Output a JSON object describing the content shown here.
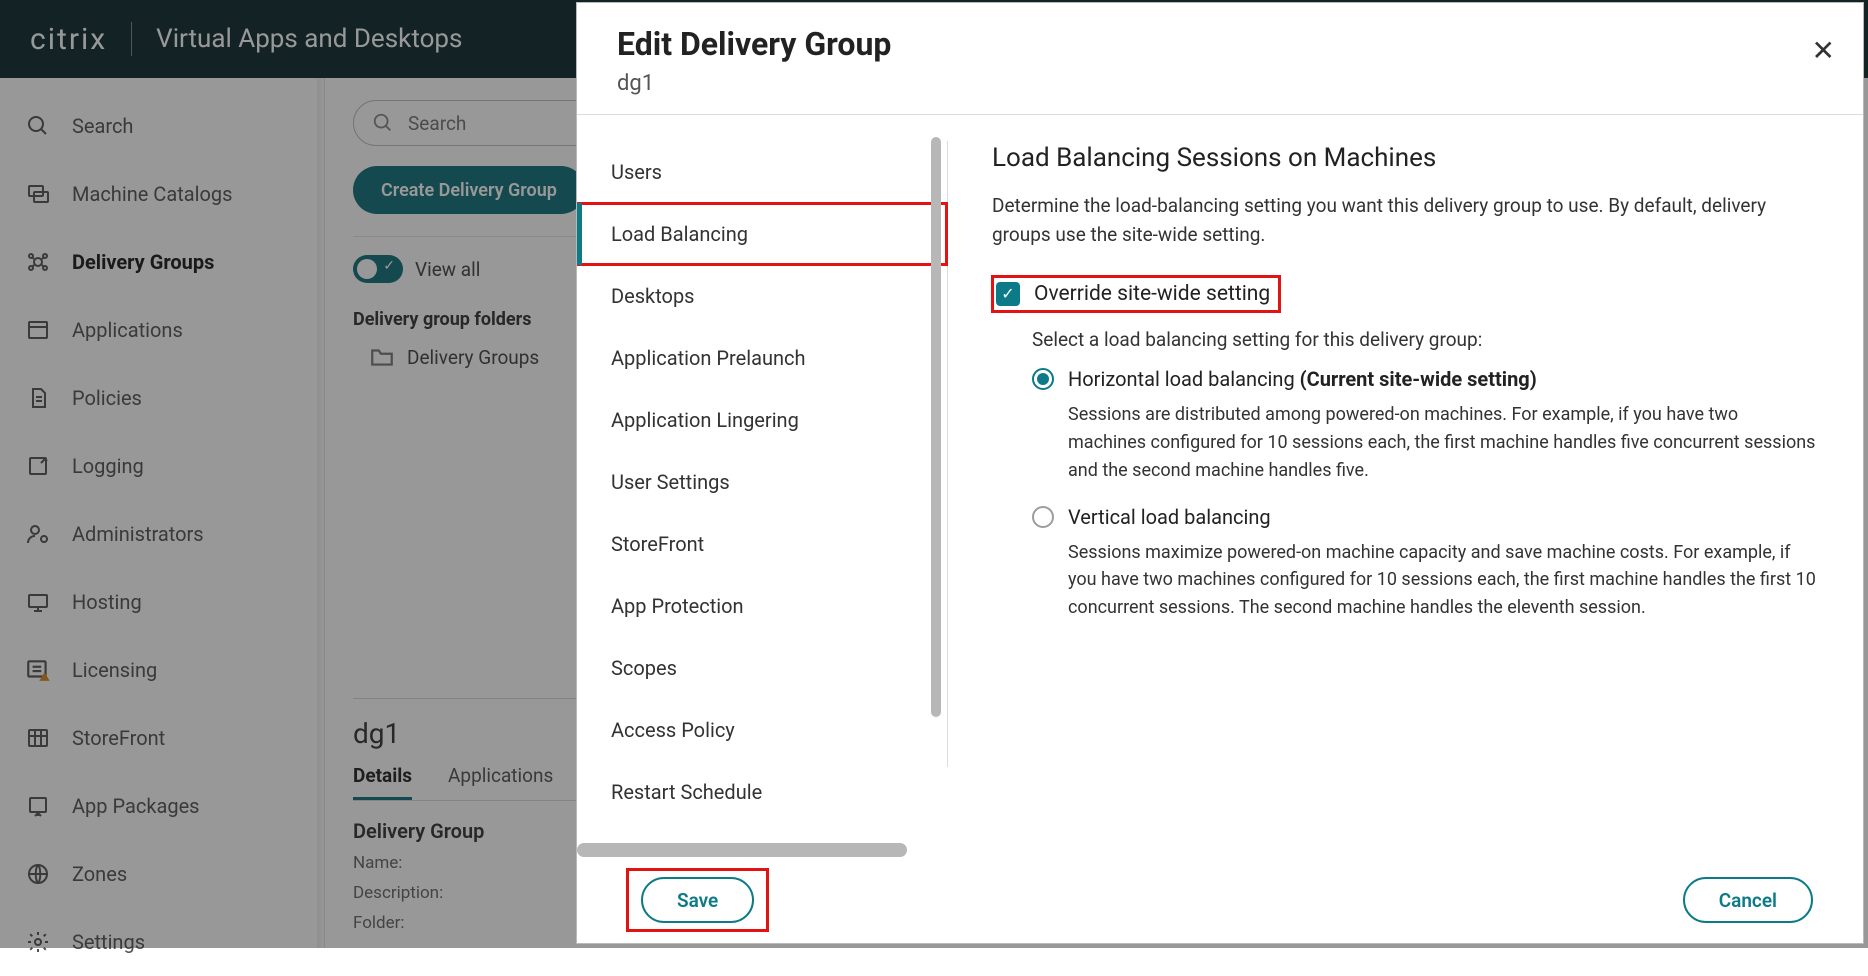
{
  "header": {
    "brand": "citrix",
    "product": "Virtual Apps and Desktops"
  },
  "leftnav": [
    {
      "id": "search",
      "label": "Search"
    },
    {
      "id": "machine-catalogs",
      "label": "Machine Catalogs"
    },
    {
      "id": "delivery-groups",
      "label": "Delivery Groups",
      "active": true
    },
    {
      "id": "applications",
      "label": "Applications"
    },
    {
      "id": "policies",
      "label": "Policies"
    },
    {
      "id": "logging",
      "label": "Logging"
    },
    {
      "id": "administrators",
      "label": "Administrators"
    },
    {
      "id": "hosting",
      "label": "Hosting"
    },
    {
      "id": "licensing",
      "label": "Licensing"
    },
    {
      "id": "storefront",
      "label": "StoreFront"
    },
    {
      "id": "app-packages",
      "label": "App Packages"
    },
    {
      "id": "zones",
      "label": "Zones"
    },
    {
      "id": "settings",
      "label": "Settings"
    }
  ],
  "main": {
    "search_placeholder": "Search",
    "create_button": "Create Delivery Group",
    "viewall_label": "View all",
    "folders_header": "Delivery group folders",
    "folder_root": "Delivery Groups"
  },
  "details": {
    "title": "dg1",
    "tabs": [
      "Details",
      "Applications"
    ],
    "active_tab": "Details",
    "section": "Delivery Group",
    "kv": [
      "Name:",
      "Description:",
      "Folder:"
    ]
  },
  "dialog": {
    "title": "Edit Delivery Group",
    "subtitle": "dg1",
    "nav": [
      "Users",
      "Load Balancing",
      "Desktops",
      "Application Prelaunch",
      "Application Lingering",
      "User Settings",
      "StoreFront",
      "App Protection",
      "Scopes",
      "Access Policy",
      "Restart Schedule"
    ],
    "nav_active": "Load Balancing",
    "content": {
      "heading": "Load Balancing Sessions on Machines",
      "description": "Determine the load-balancing setting you want this delivery group to use. By default, delivery groups use the site-wide setting.",
      "override_label": "Override site-wide setting",
      "override_checked": true,
      "select_help": "Select a load balancing setting for this delivery group:",
      "radio_selected": "horizontal",
      "horizontal": {
        "label": "Horizontal load balancing",
        "suffix": "(Current site-wide setting)",
        "desc": "Sessions are distributed among powered-on machines. For example, if you have two machines configured for 10 sessions each, the first machine handles five concurrent sessions and the second machine handles five."
      },
      "vertical": {
        "label": "Vertical load balancing",
        "desc": "Sessions maximize powered-on machine capacity and save machine costs. For example, if you have two machines configured for 10 sessions each, the first machine handles the first 10 concurrent sessions. The second machine handles the eleventh session."
      }
    },
    "buttons": {
      "save": "Save",
      "cancel": "Cancel"
    }
  }
}
